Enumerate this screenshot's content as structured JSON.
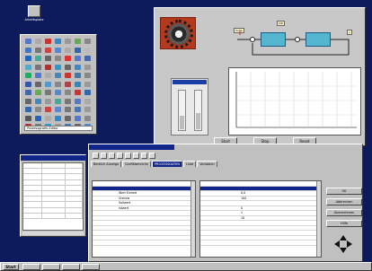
{
  "desktop": {
    "icon_label": "Arbeitsplatz"
  },
  "palette": {
    "status": "Prozessgrafik-Editor",
    "cells": [
      "#5577cc",
      "#aaaaaa",
      "#cc3333",
      "#3388cc",
      "#999999",
      "#66aa55",
      "#888888",
      "#4477bb",
      "#777777",
      "#cc4444",
      "#5588dd",
      "#aaaaaa",
      "#3366aa",
      "#bbbbbb",
      "#2266bb",
      "#44aa99",
      "#666666",
      "#888888",
      "#dd3333",
      "#5577cc",
      "#4466aa",
      "#55aacc",
      "#777777",
      "#aa3333",
      "#3399cc",
      "#666666",
      "#4488cc",
      "#999999",
      "#22aa66",
      "#5577cc",
      "#aaaaaa",
      "#4488bb",
      "#cc3333",
      "#4477aa",
      "#888888",
      "#3355aa",
      "#666666",
      "#5599cc",
      "#888888",
      "#aa4444",
      "#3388bb",
      "#999999",
      "#4466aa",
      "#66aa55",
      "#777777",
      "#5588cc",
      "#888888",
      "#cc3333",
      "#3366aa",
      "#666666",
      "#4488bb",
      "#999999",
      "#44aa99",
      "#777777",
      "#5577cc",
      "#aaaaaa",
      "#3366aa",
      "#888888",
      "#cc4444",
      "#5588dd",
      "#777777",
      "#4477bb",
      "#999999",
      "#555555",
      "#2266bb",
      "#aaaaaa",
      "#3388cc",
      "#666666",
      "#5577cc",
      "#888888",
      "#aa3333",
      "#777777",
      "#3399cc",
      "#999999",
      "#4477aa",
      "#666666",
      "#5588cc"
    ]
  },
  "graphic": {
    "buttons": [
      "Start",
      "Stop",
      "Reset"
    ],
    "gauge_levels": [
      0.35,
      0.4
    ],
    "label_setpoint": "Sollw",
    "label_ctrl": "PID",
    "label_out": "y"
  },
  "tablewin": {
    "rows": [
      [
        "",
        "",
        ""
      ],
      [
        "",
        "",
        ""
      ],
      [
        "",
        "",
        ""
      ],
      [
        "",
        "",
        ""
      ],
      [
        "",
        "",
        ""
      ],
      [
        "",
        "",
        ""
      ],
      [
        "",
        "",
        ""
      ],
      [
        "",
        "",
        ""
      ],
      [
        "",
        "",
        ""
      ],
      [
        "",
        "",
        ""
      ]
    ]
  },
  "dbwin": {
    "tabs": [
      "Bereich Anzeige",
      "Grafikbereiche",
      "PROZESSDATEN",
      "Liste",
      "Variablen"
    ],
    "left_rows": [
      [
        "",
        ""
      ],
      [
        "",
        ""
      ],
      [
        "",
        "Wert Einheit"
      ],
      [
        "",
        "Grenzw"
      ],
      [
        "",
        "Sollwert"
      ],
      [
        "",
        "Istwert"
      ],
      [
        "",
        ""
      ],
      [
        "",
        ""
      ],
      [
        "",
        ""
      ],
      [
        "",
        ""
      ],
      [
        "",
        ""
      ],
      [
        "",
        ""
      ],
      [
        "",
        ""
      ]
    ],
    "right_rows": [
      [
        "",
        ""
      ],
      [
        "",
        ""
      ],
      [
        "",
        "0,0"
      ],
      [
        "",
        "100"
      ],
      [
        "",
        ""
      ],
      [
        "",
        "0"
      ],
      [
        "",
        "1"
      ],
      [
        "",
        "10"
      ],
      [
        "",
        ""
      ],
      [
        "",
        ""
      ],
      [
        "",
        ""
      ],
      [
        "",
        ""
      ],
      [
        "",
        ""
      ]
    ],
    "side_buttons": [
      "OK",
      "Abbrechen",
      "Übernehmen",
      "Hilfe"
    ]
  },
  "taskbar": {
    "start": "Start"
  }
}
